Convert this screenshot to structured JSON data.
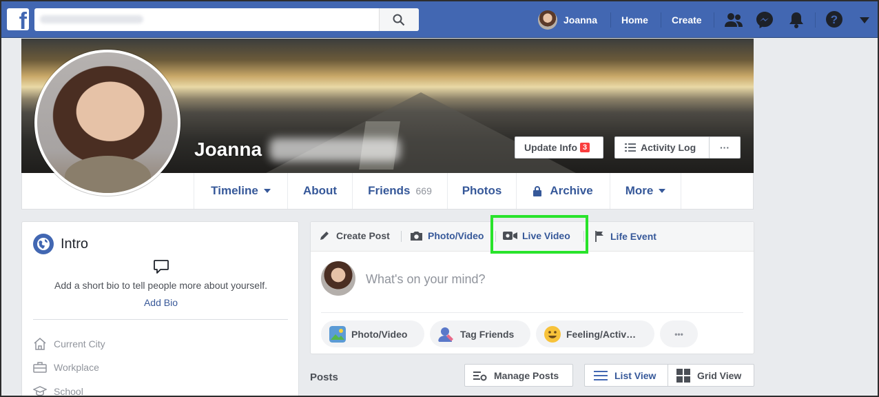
{
  "topbar": {
    "search_placeholder": "",
    "user_name": "Joanna",
    "home_label": "Home",
    "create_label": "Create",
    "icons": [
      "facebook-logo",
      "search-icon",
      "friends-icon",
      "messenger-icon",
      "notifications-bell-icon",
      "help-icon",
      "dropdown-caret-icon"
    ]
  },
  "cover": {
    "profile_name": "Joanna",
    "update_info_label": "Update Info",
    "update_info_badge": "3",
    "activity_log_label": "Activity Log",
    "more_label": "···"
  },
  "tabs": {
    "timeline": "Timeline",
    "about": "About",
    "friends": "Friends",
    "friends_count": "669",
    "photos": "Photos",
    "archive": "Archive",
    "more": "More"
  },
  "intro": {
    "title": "Intro",
    "bio_prompt": "Add a short bio to tell people more about yourself.",
    "add_bio": "Add Bio",
    "rows": [
      "Current City",
      "Workplace",
      "School"
    ]
  },
  "composer": {
    "create_post": "Create Post",
    "photo_video_tab": "Photo/Video",
    "live_video": "Live Video",
    "life_event": "Life Event",
    "placeholder": "What's on your mind?",
    "pill_photo_video": "Photo/Video",
    "pill_tag_friends": "Tag Friends",
    "pill_feeling": "Feeling/Activ…",
    "pill_more": "•••"
  },
  "posts": {
    "label": "Posts",
    "manage_posts": "Manage Posts",
    "list_view": "List View",
    "grid_view": "Grid View"
  },
  "colors": {
    "brand": "#4267b2",
    "link": "#365899",
    "highlight": "#29e32b",
    "badge": "#fa3e3e"
  }
}
